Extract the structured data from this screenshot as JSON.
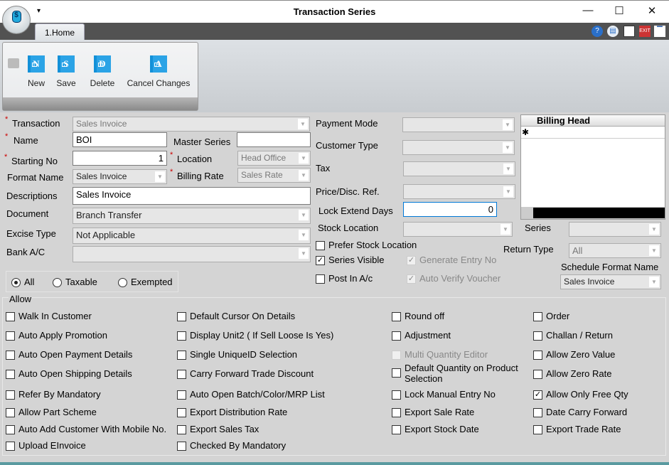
{
  "window": {
    "title": "Transaction Series",
    "minimize": "—",
    "maximize": "☐",
    "close": "✕",
    "qat": "▾"
  },
  "tab": {
    "label": "1.Home"
  },
  "toolbar": {
    "buttons": [
      {
        "label": "New",
        "glyph": "N"
      },
      {
        "label": "Save",
        "glyph": "S"
      },
      {
        "label": "Delete",
        "glyph": "D"
      },
      {
        "label": "Cancel Changes",
        "glyph": "A"
      }
    ]
  },
  "topicons": [
    "help-icon",
    "monitor-icon",
    "report-icon",
    "exit-icon",
    "minimize-ribbon-icon"
  ],
  "form": {
    "transaction": {
      "label": "Transaction",
      "value": "Sales Invoice"
    },
    "name": {
      "label": "Name",
      "value": "BOI"
    },
    "master_series": {
      "label": "Master Series",
      "value": ""
    },
    "starting_no": {
      "label": "Starting No",
      "value": "1"
    },
    "location": {
      "label": "Location",
      "value": "Head Office"
    },
    "format_name": {
      "label": "Format Name",
      "value": "Sales Invoice"
    },
    "billing_rate": {
      "label": "Billing Rate",
      "value": "Sales Rate"
    },
    "descriptions": {
      "label": "Descriptions",
      "value": "Sales Invoice"
    },
    "document": {
      "label": "Document",
      "value": "Branch Transfer"
    },
    "excise_type": {
      "label": "Excise Type",
      "value": "Not Applicable"
    },
    "bank_ac": {
      "label": "Bank A/C",
      "value": ""
    },
    "payment_mode": {
      "label": "Payment Mode",
      "value": ""
    },
    "customer_type": {
      "label": "Customer Type",
      "value": ""
    },
    "tax": {
      "label": "Tax",
      "value": ""
    },
    "price_disc_ref": {
      "label": "Price/Disc. Ref.",
      "value": ""
    },
    "lock_extend_days": {
      "label": "Lock Extend Days",
      "value": "0"
    },
    "stock_location": {
      "label": "Stock Location",
      "value": ""
    },
    "series": {
      "label": "Series",
      "value": ""
    },
    "return_type": {
      "label": "Return Type",
      "value": "All"
    },
    "schedule_format": {
      "label": "Schedule Format Name",
      "value": "Sales Invoice"
    },
    "prefer_stock_location": {
      "label": "Prefer Stock Location",
      "checked": false
    },
    "series_visible": {
      "label": "Series Visible",
      "checked": true
    },
    "generate_entry_no": {
      "label": "Generate Entry No",
      "checked": true
    },
    "post_in_ac": {
      "label": "Post In A/c",
      "checked": false
    },
    "auto_verify_voucher": {
      "label": "Auto Verify Voucher",
      "checked": true
    }
  },
  "grid": {
    "header": "Billing Head",
    "new_row_marker": "✱"
  },
  "tax_filter": {
    "options": [
      "All",
      "Taxable",
      "Exempted"
    ],
    "selected": "All"
  },
  "allow": {
    "title": "Allow",
    "items": [
      {
        "label": "Walk In Customer",
        "checked": false
      },
      {
        "label": "Default Cursor On Details",
        "checked": false
      },
      {
        "label": "Round off",
        "checked": false
      },
      {
        "label": "Order",
        "checked": false
      },
      {
        "label": "Auto Apply Promotion",
        "checked": false
      },
      {
        "label": "Display Unit2 ( If Sell Loose Is Yes)",
        "checked": false
      },
      {
        "label": "Adjustment",
        "checked": false
      },
      {
        "label": "Challan / Return",
        "checked": false
      },
      {
        "label": "Auto Open Payment Details",
        "checked": false
      },
      {
        "label": "Single UniqueID Selection",
        "checked": false
      },
      {
        "label": "Multi Quantity Editor",
        "checked": false,
        "disabled": true
      },
      {
        "label": "Allow Zero Value",
        "checked": false
      },
      {
        "label": "Auto Open Shipping Details",
        "checked": false
      },
      {
        "label": "Carry Forward Trade Discount",
        "checked": false
      },
      {
        "label": "Default Quantity on Product Selection",
        "checked": false
      },
      {
        "label": "Allow Zero Rate",
        "checked": false
      },
      {
        "label": "Refer By Mandatory",
        "checked": false
      },
      {
        "label": "Auto Open Batch/Color/MRP List",
        "checked": false
      },
      {
        "label": "Lock Manual Entry No",
        "checked": false
      },
      {
        "label": "Allow Only Free Qty",
        "checked": true
      },
      {
        "label": "Allow Part Scheme",
        "checked": false
      },
      {
        "label": "Export Distribution Rate",
        "checked": false
      },
      {
        "label": "Export Sale Rate",
        "checked": false
      },
      {
        "label": "Date Carry Forward",
        "checked": false
      },
      {
        "label": "Auto Add Customer With Mobile No.",
        "checked": false
      },
      {
        "label": "Export Sales Tax",
        "checked": false
      },
      {
        "label": "Export Stock Date",
        "checked": false
      },
      {
        "label": "Export Trade Rate",
        "checked": false
      },
      {
        "label": "Upload EInvoice",
        "checked": false
      },
      {
        "label": "Checked By Mandatory",
        "checked": false
      }
    ]
  }
}
